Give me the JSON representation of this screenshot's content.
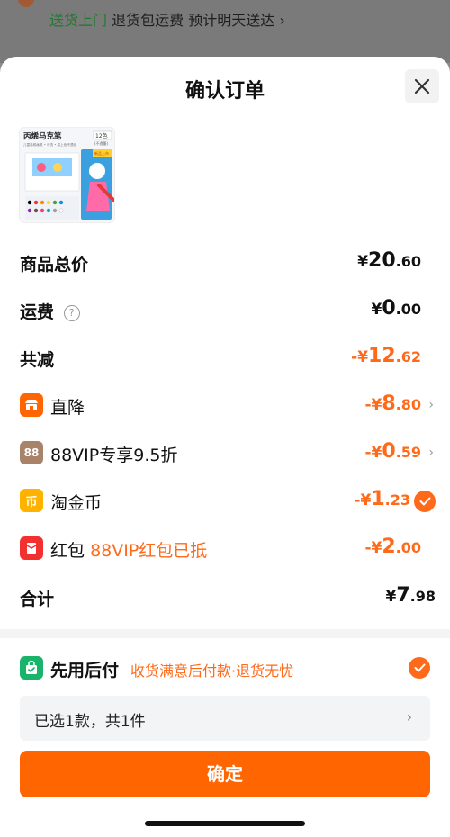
{
  "banner": {
    "delivery": "送货上门",
    "refund": "退货包运费",
    "eta": "预计明天送达",
    "chevron": "›"
  },
  "sheet": {
    "title": "确认订单",
    "close_icon": "close-icon"
  },
  "product": {
    "title_text": "丙烯马克笔",
    "count_badge": "12色",
    "count_sub": "(不透墨)",
    "subtitle": "儿童涂鸦画笔 • 可洗 • 易上色不透纸",
    "new_tag": "新品上市"
  },
  "price": {
    "total": {
      "label": "商品总价",
      "currency": "¥",
      "integer": "20",
      "decimal": ".60"
    },
    "shipping": {
      "label": "运费",
      "currency": "¥",
      "integer": "0",
      "decimal": ".00",
      "help_icon": "?"
    },
    "reduction": {
      "label": "共减",
      "currency": "-¥",
      "integer": "12",
      "decimal": ".62"
    },
    "discounts": [
      {
        "name": "直降",
        "icon": "store-icon",
        "currency": "-¥",
        "integer": "8",
        "decimal": ".80",
        "chevron": "›"
      },
      {
        "name": "88VIP专享9.5折",
        "icon_text": "88",
        "currency": "-¥",
        "integer": "0",
        "decimal": ".59",
        "chevron": "›"
      },
      {
        "name": "淘金币",
        "icon_text": "币",
        "currency": "-¥",
        "integer": "1",
        "decimal": ".23",
        "checked": true
      },
      {
        "name": "红包",
        "tag": "88VIP红包已抵",
        "icon": "red-envelope-icon",
        "currency": "-¥",
        "integer": "2",
        "decimal": ".00"
      }
    ],
    "sum": {
      "label": "合计",
      "currency": "¥",
      "integer": "7",
      "decimal": ".98"
    }
  },
  "pay_later": {
    "name": "先用后付",
    "desc": "收货满意后付款·退货无忧",
    "checked": true
  },
  "selection": {
    "text": "已选1款，共1件",
    "chevron": "›"
  },
  "confirm_button": {
    "label": "确定"
  },
  "colors": {
    "accent": "#ff6500",
    "discount_text": "#ff6a1a",
    "green": "#19b36b"
  }
}
